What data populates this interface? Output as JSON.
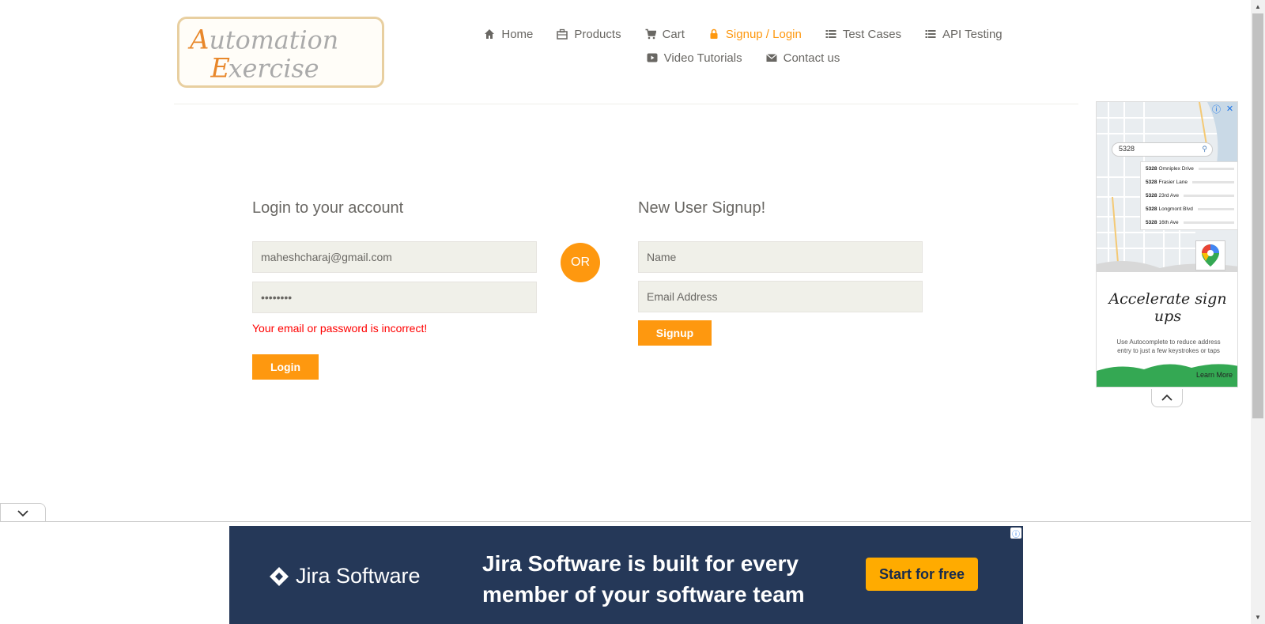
{
  "logo": {
    "line1": "Automation",
    "line2": "Exercise"
  },
  "nav": {
    "row1": [
      {
        "label": "Home",
        "icon": "home-icon",
        "active": false
      },
      {
        "label": "Products",
        "icon": "products-icon",
        "active": false
      },
      {
        "label": "Cart",
        "icon": "cart-icon",
        "active": false
      },
      {
        "label": "Signup / Login",
        "icon": "lock-icon",
        "active": true
      },
      {
        "label": "Test Cases",
        "icon": "list-icon",
        "active": false
      },
      {
        "label": "API Testing",
        "icon": "list-icon",
        "active": false
      }
    ],
    "row2": [
      {
        "label": "Video Tutorials",
        "icon": "youtube-icon",
        "active": false
      },
      {
        "label": "Contact us",
        "icon": "envelope-icon",
        "active": false
      }
    ]
  },
  "login": {
    "title": "Login to your account",
    "email_value": "maheshcharaj@gmail.com",
    "password_value": "••••••••",
    "error": "Your email or password is incorrect!",
    "button": "Login"
  },
  "or_label": "OR",
  "signup": {
    "title": "New User Signup!",
    "name_placeholder": "Name",
    "email_placeholder": "Email Address",
    "button": "Signup"
  },
  "side_ad": {
    "search_value": "5328",
    "suggestions": [
      {
        "num": "5328",
        "street": "Omniplex Drive"
      },
      {
        "num": "5328",
        "street": "Frasier Lane"
      },
      {
        "num": "5328",
        "street": "23rd Ave"
      },
      {
        "num": "5328",
        "street": "Longmont Blvd"
      },
      {
        "num": "5328",
        "street": "16th Ave"
      }
    ],
    "tagline": "Accelerate sign ups",
    "description": "Use Autocomplete to reduce address entry to just a few keystrokes or taps",
    "cta": "Learn More"
  },
  "bottom_ad": {
    "brand": "Jira Software",
    "headline": "Jira Software is built for every member of your software team",
    "cta": "Start for free"
  },
  "colors": {
    "accent": "#FE980F",
    "error": "#FF0000",
    "jira_bg": "#253858",
    "jira_cta": "#FFAB00",
    "input_bg": "#F0F0E9"
  }
}
